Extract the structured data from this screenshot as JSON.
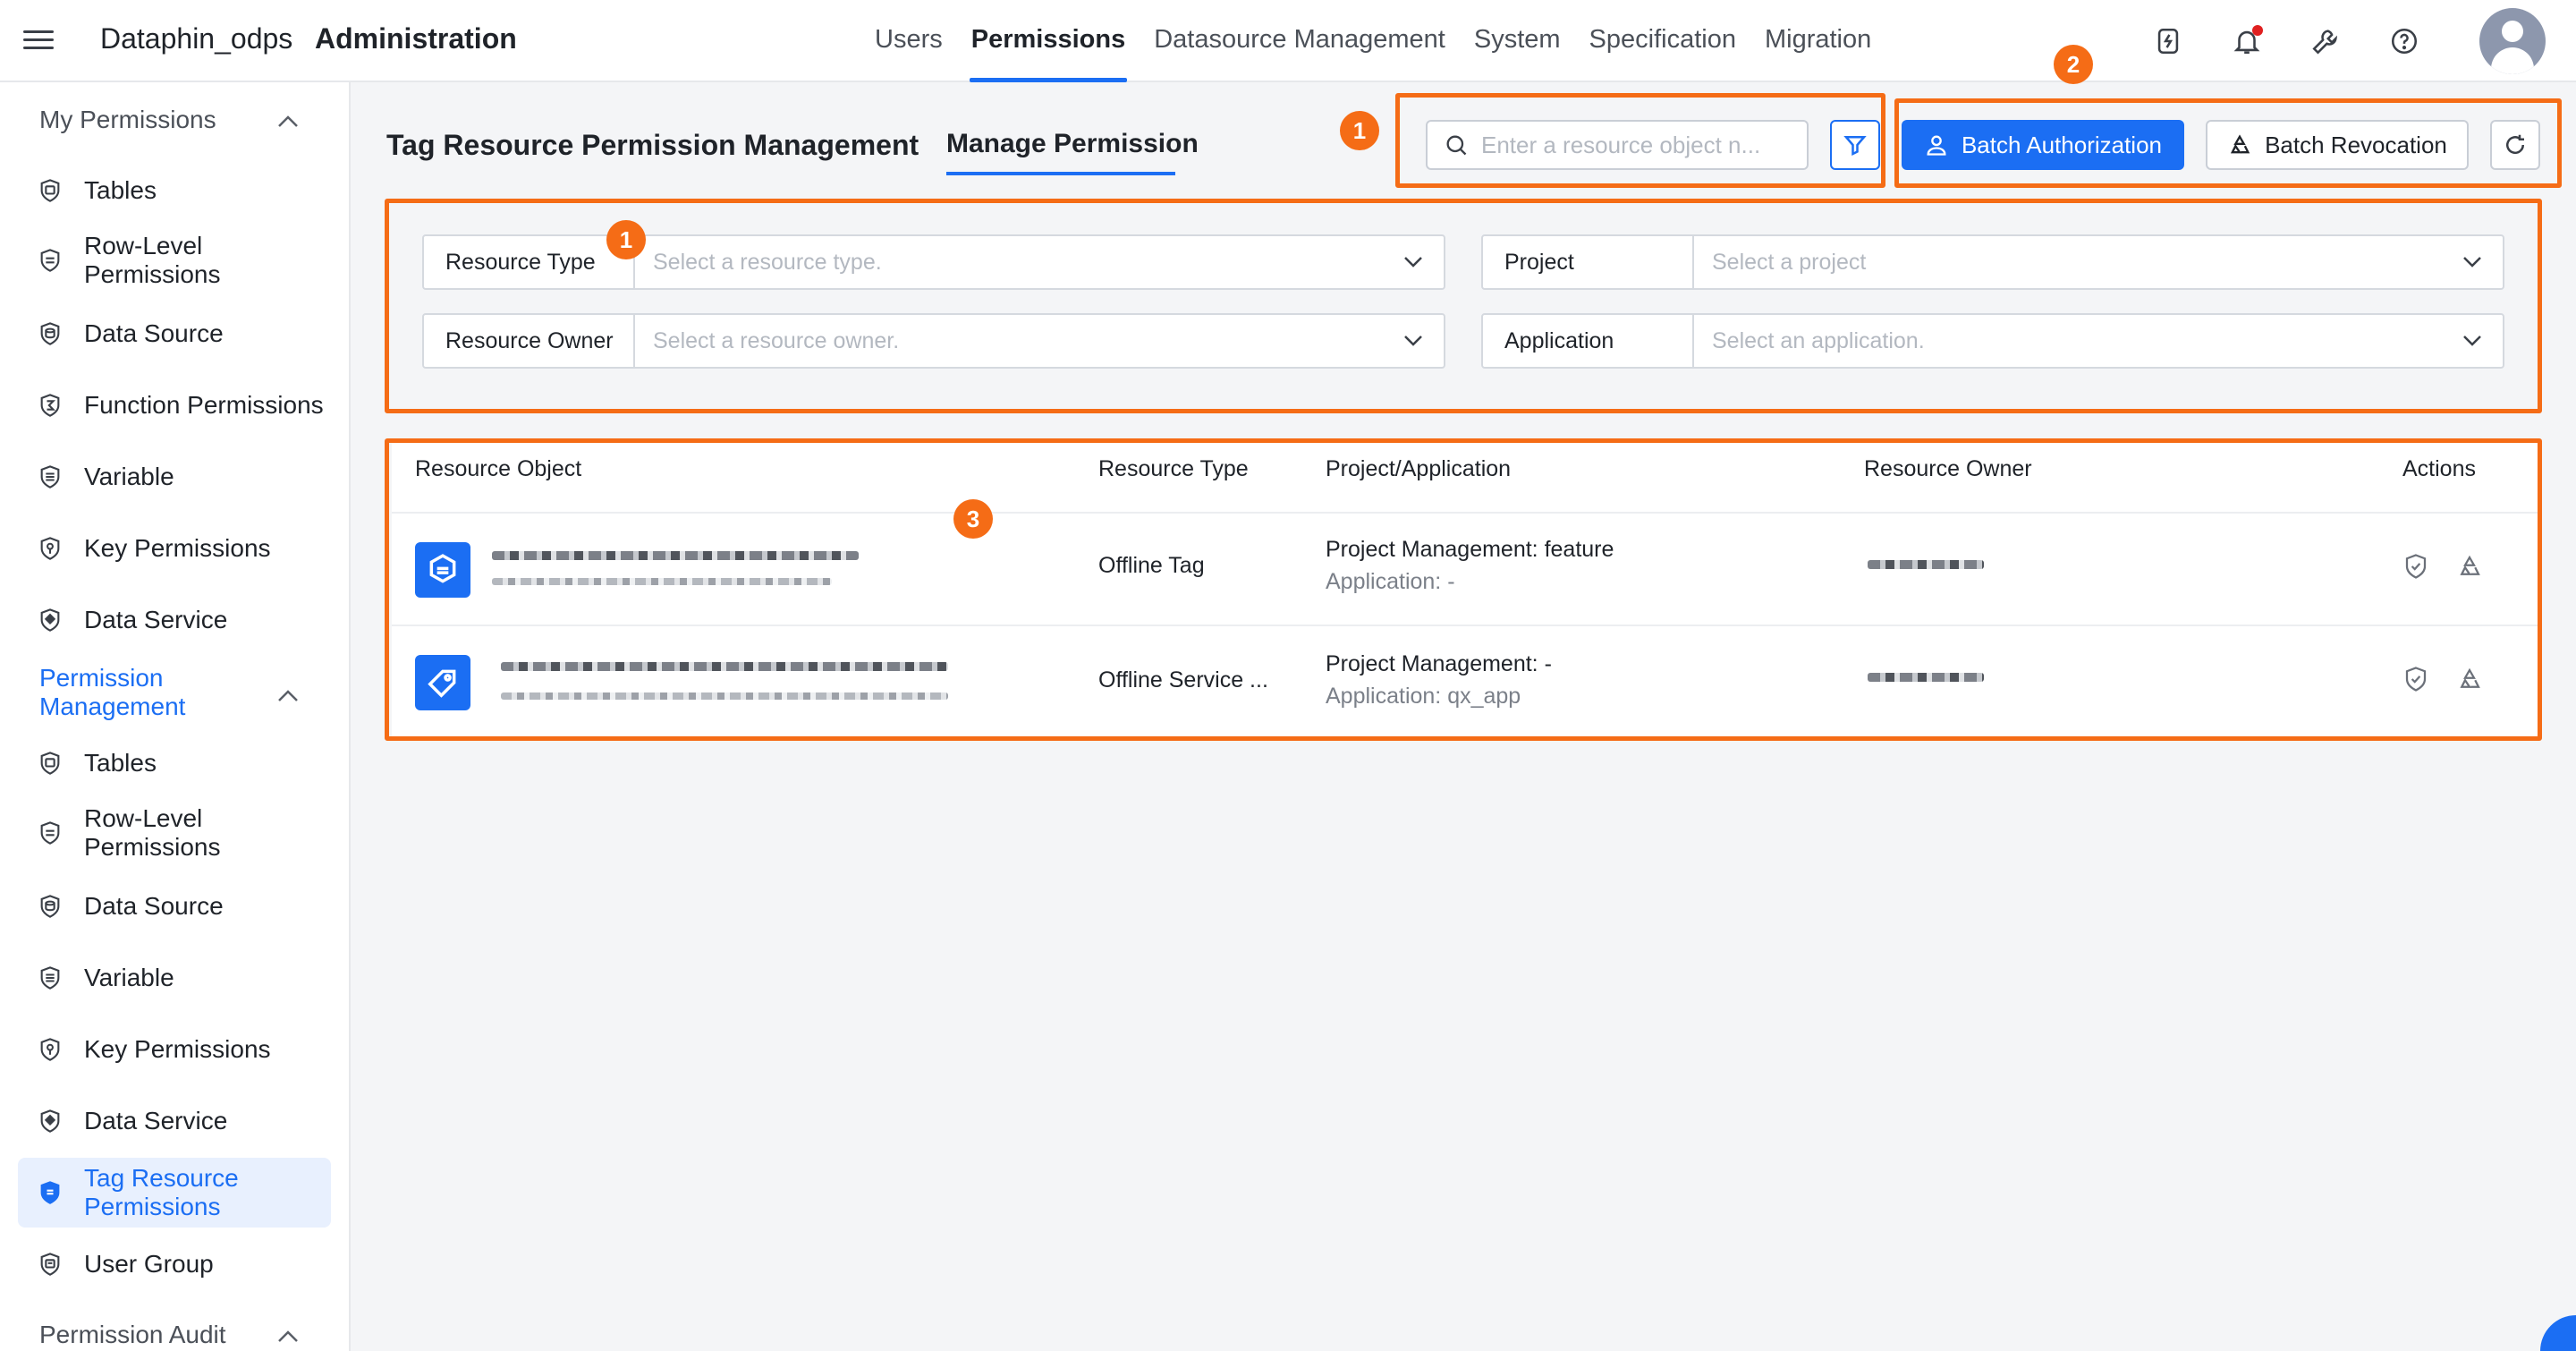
{
  "header": {
    "brand": "Dataphin_odps",
    "title": "Administration",
    "nav": [
      {
        "label": "Users"
      },
      {
        "label": "Permissions"
      },
      {
        "label": "Datasource Management"
      },
      {
        "label": "System"
      },
      {
        "label": "Specification"
      },
      {
        "label": "Migration"
      }
    ],
    "active_nav": "Permissions",
    "icons": [
      "power-icon",
      "bell-icon",
      "wrench-icon",
      "help-icon",
      "avatar"
    ],
    "bell_has_notification": true
  },
  "sidebar": {
    "my_permissions": {
      "label": "My Permissions",
      "items": [
        {
          "label": "Tables"
        },
        {
          "label": "Row-Level Permissions"
        },
        {
          "label": "Data Source"
        },
        {
          "label": "Function Permissions"
        },
        {
          "label": "Variable"
        },
        {
          "label": "Key Permissions"
        },
        {
          "label": "Data Service"
        }
      ]
    },
    "permission_management": {
      "label": "Permission Management",
      "items": [
        {
          "label": "Tables"
        },
        {
          "label": "Row-Level Permissions"
        },
        {
          "label": "Data Source"
        },
        {
          "label": "Variable"
        },
        {
          "label": "Key Permissions"
        },
        {
          "label": "Data Service"
        },
        {
          "label": "Tag Resource Permissions"
        },
        {
          "label": "User Group"
        }
      ],
      "active_item": "Tag Resource Permissions"
    },
    "permission_audit": {
      "label": "Permission Audit"
    }
  },
  "main": {
    "title": "Tag Resource Permission Management",
    "tab": "Manage Permission",
    "search": {
      "placeholder": "Enter a resource object n..."
    },
    "buttons": {
      "batch_authorization": "Batch Authorization",
      "batch_revocation": "Batch Revocation"
    },
    "filters": [
      {
        "label": "Resource Type",
        "placeholder": "Select a resource type."
      },
      {
        "label": "Project",
        "placeholder": "Select a project"
      },
      {
        "label": "Resource Owner",
        "placeholder": "Select a resource owner."
      },
      {
        "label": "Application",
        "placeholder": "Select an application."
      }
    ],
    "table": {
      "columns": [
        "Resource Object",
        "Resource Type",
        "Project/Application",
        "Resource Owner",
        "Actions"
      ],
      "rows": [
        {
          "resource_type": "Offline Tag",
          "project": "Project Management: feature",
          "application": "Application: -"
        },
        {
          "resource_type": "Offline Service ...",
          "project": "Project Management: -",
          "application": "Application: qx_app"
        }
      ]
    }
  },
  "annotations": {
    "search_filter_badge": "1",
    "filters_badge": "1",
    "buttons_badge": "2",
    "table_badge": "3",
    "color": "#f56c16"
  },
  "colors": {
    "accent": "#1b6ef3",
    "annotation": "#f56c16"
  }
}
